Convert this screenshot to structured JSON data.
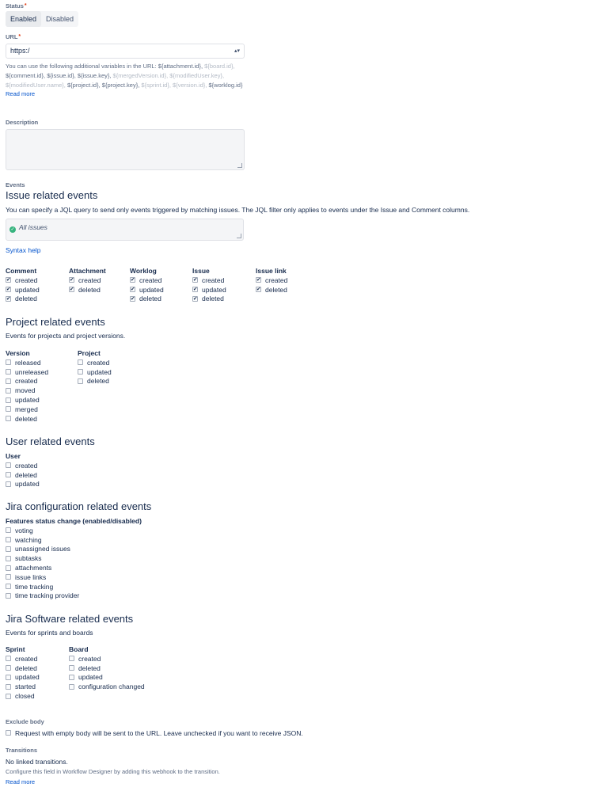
{
  "status": {
    "label": "Status",
    "required_mark": "*",
    "options": [
      "Enabled",
      "Disabled"
    ],
    "selected": "Enabled"
  },
  "url": {
    "label": "URL",
    "required_mark": "*",
    "value": "https:/",
    "help_prefix": "You can use the following additional variables in the URL:",
    "variables": [
      {
        "text": "${attachment.id},",
        "dim": false
      },
      {
        "text": "${board.id},",
        "dim": true
      },
      {
        "text": "${comment.id},",
        "dim": false
      },
      {
        "text": "${issue.id},",
        "dim": false
      },
      {
        "text": "${issue.key},",
        "dim": false
      },
      {
        "text": "${mergedVersion.id},",
        "dim": true
      },
      {
        "text": "${modifiedUser.key},",
        "dim": true
      },
      {
        "text": "${modifiedUser.name},",
        "dim": true
      },
      {
        "text": "${project.id},",
        "dim": false
      },
      {
        "text": "${project.key},",
        "dim": false
      },
      {
        "text": "${sprint.id},",
        "dim": true
      },
      {
        "text": "${version.id},",
        "dim": true
      },
      {
        "text": "${worklog.id}",
        "dim": false
      }
    ],
    "read_more": "Read more"
  },
  "description": {
    "label": "Description",
    "value": ""
  },
  "events": {
    "label": "Events",
    "issue": {
      "heading": "Issue related events",
      "desc": "You can specify a JQL query to send only events triggered by matching issues. The JQL filter only applies to events under the Issue and Comment columns.",
      "jql_value": "All issues",
      "syntax_help": "Syntax help",
      "columns": [
        {
          "title": "Comment",
          "items": [
            {
              "label": "created",
              "checked": true
            },
            {
              "label": "updated",
              "checked": true
            },
            {
              "label": "deleted",
              "checked": true
            }
          ]
        },
        {
          "title": "Attachment",
          "items": [
            {
              "label": "created",
              "checked": true
            },
            {
              "label": "deleted",
              "checked": true
            }
          ]
        },
        {
          "title": "Worklog",
          "items": [
            {
              "label": "created",
              "checked": true
            },
            {
              "label": "updated",
              "checked": true
            },
            {
              "label": "deleted",
              "checked": true
            }
          ]
        },
        {
          "title": "Issue",
          "items": [
            {
              "label": "created",
              "checked": true
            },
            {
              "label": "updated",
              "checked": true
            },
            {
              "label": "deleted",
              "checked": true
            }
          ]
        },
        {
          "title": "Issue link",
          "items": [
            {
              "label": "created",
              "checked": true
            },
            {
              "label": "deleted",
              "checked": true
            }
          ]
        }
      ]
    },
    "project": {
      "heading": "Project related events",
      "desc": "Events for projects and project versions.",
      "columns": [
        {
          "title": "Version",
          "items": [
            {
              "label": "released",
              "checked": false
            },
            {
              "label": "unreleased",
              "checked": false
            },
            {
              "label": "created",
              "checked": false
            },
            {
              "label": "moved",
              "checked": false
            },
            {
              "label": "updated",
              "checked": false
            },
            {
              "label": "merged",
              "checked": false
            },
            {
              "label": "deleted",
              "checked": false
            }
          ]
        },
        {
          "title": "Project",
          "items": [
            {
              "label": "created",
              "checked": false
            },
            {
              "label": "updated",
              "checked": false
            },
            {
              "label": "deleted",
              "checked": false
            }
          ]
        }
      ]
    },
    "user": {
      "heading": "User related events",
      "columns": [
        {
          "title": "User",
          "items": [
            {
              "label": "created",
              "checked": false
            },
            {
              "label": "deleted",
              "checked": false
            },
            {
              "label": "updated",
              "checked": false
            }
          ]
        }
      ]
    },
    "config": {
      "heading": "Jira configuration related events",
      "columns": [
        {
          "title": "Features status change (enabled/disabled)",
          "items": [
            {
              "label": "voting",
              "checked": false
            },
            {
              "label": "watching",
              "checked": false
            },
            {
              "label": "unassigned issues",
              "checked": false
            },
            {
              "label": "subtasks",
              "checked": false
            },
            {
              "label": "attachments",
              "checked": false
            },
            {
              "label": "issue links",
              "checked": false
            },
            {
              "label": "time tracking",
              "checked": false
            },
            {
              "label": "time tracking provider",
              "checked": false
            }
          ]
        }
      ]
    },
    "software": {
      "heading": "Jira Software related events",
      "desc": "Events for sprints and boards",
      "columns": [
        {
          "title": "Sprint",
          "items": [
            {
              "label": "created",
              "checked": false
            },
            {
              "label": "deleted",
              "checked": false
            },
            {
              "label": "updated",
              "checked": false
            },
            {
              "label": "started",
              "checked": false
            },
            {
              "label": "closed",
              "checked": false
            }
          ]
        },
        {
          "title": "Board",
          "items": [
            {
              "label": "created",
              "checked": false
            },
            {
              "label": "deleted",
              "checked": false
            },
            {
              "label": "updated",
              "checked": false
            },
            {
              "label": "configuration changed",
              "checked": false
            }
          ]
        }
      ]
    }
  },
  "exclude_body": {
    "label": "Exclude body",
    "checkbox_label": "Request with empty body will be sent to the URL. Leave unchecked if you want to receive JSON.",
    "checked": false
  },
  "transitions": {
    "label": "Transitions",
    "value": "No linked transitions.",
    "help": "Configure this field in Workflow Designer by adding this webhook to the transition.",
    "read_more": "Read more"
  },
  "icons": {
    "select_arrows": "updown-arrows-icon",
    "jql_status": "check-circle-icon",
    "resize": "resize-handle-icon"
  },
  "colors": {
    "link": "#0052cc",
    "text": "#172b4d",
    "muted": "#5e6c84",
    "dim": "#b3bac5",
    "success": "#36b37e",
    "required": "#de350b"
  }
}
